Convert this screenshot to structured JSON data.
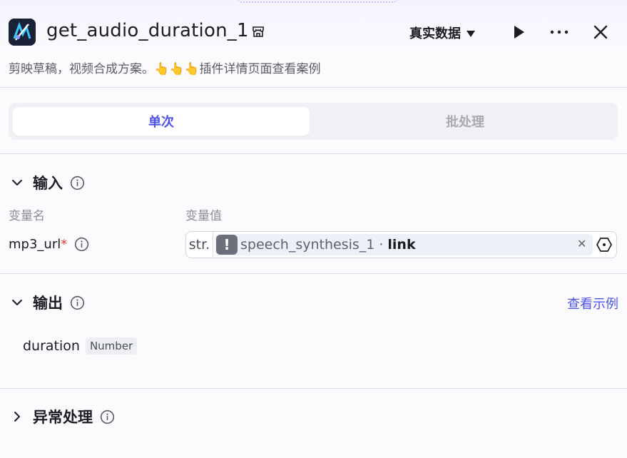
{
  "header": {
    "title": "get_audio_duration_1",
    "data_mode": "真实数据"
  },
  "description": "剪映草稿，视频合成方案。👆👆👆插件详情页面查看案例",
  "tabs": [
    "单次",
    "批处理"
  ],
  "input": {
    "title": "输入",
    "col_name": "变量名",
    "col_value": "变量值",
    "param": {
      "name": "mp3_url",
      "required_mark": "*",
      "type": "str.",
      "ref_node": "speech_synthesis_1",
      "ref_sep": "·",
      "ref_field": "link",
      "warning": "!"
    }
  },
  "output": {
    "title": "输出",
    "view_example": "查看示例",
    "field": {
      "name": "duration",
      "type": "Number"
    }
  },
  "exception": {
    "title": "异常处理"
  },
  "colors": {
    "accent": "#4d53e8",
    "required": "#e53935"
  },
  "icons": [
    "app-logo",
    "store-icon",
    "play-icon",
    "more-icon",
    "close-icon",
    "chevron-down-icon",
    "chevron-right-icon",
    "info-icon",
    "settings-hex-icon"
  ]
}
